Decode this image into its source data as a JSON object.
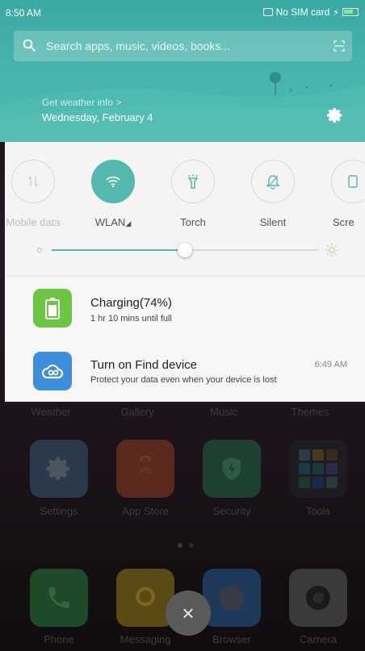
{
  "status_bar": {
    "time": "8:50 AM",
    "sim_text": "No SIM card",
    "battery_level": 0.74,
    "charging_symbol": "⚡"
  },
  "search": {
    "placeholder": "Search apps, music, videos, books..."
  },
  "weather": {
    "link": "Get weather info >",
    "date": "Wednesday, February 4"
  },
  "quick_toggles": [
    {
      "label": "Mobile data",
      "state": "disabled",
      "icon": "mobile-data-icon"
    },
    {
      "label": "WLAN",
      "state": "on",
      "icon": "wifi-icon"
    },
    {
      "label": "Torch",
      "state": "off",
      "icon": "torch-icon"
    },
    {
      "label": "Silent",
      "state": "off",
      "icon": "bell-icon"
    },
    {
      "label": "Scre",
      "state": "off",
      "icon": "screenshot-icon"
    }
  ],
  "brightness": {
    "level": 0.5
  },
  "notifications": [
    {
      "title": "Charging(74%)",
      "text": "1 hr 10 mins  until full",
      "time": "",
      "icon": "battery-icon",
      "color": "#6cc644"
    },
    {
      "title": "Turn on Find device",
      "text": "Protect your data even when your device is lost",
      "time": "6:49 AM",
      "icon": "cloud-icon",
      "color": "#3e8ee0"
    }
  ],
  "home_apps": {
    "row_top_labels": [
      "Weather",
      "Gallery",
      "Music",
      "Themes"
    ],
    "row_mid": [
      {
        "label": "Settings",
        "icon": "gear-icon",
        "color": "#2b3a4a"
      },
      {
        "label": "App Store",
        "icon": "store-icon",
        "color": "#5a2a1e"
      },
      {
        "label": "Security",
        "icon": "shield-icon",
        "color": "#1e4030"
      },
      {
        "label": "Tools",
        "icon": "folder-icon",
        "color": "#1c1c22"
      }
    ],
    "dock": [
      {
        "label": "Phone",
        "icon": "phone-icon",
        "color": "#1f4a2a"
      },
      {
        "label": "Messaging",
        "icon": "message-icon",
        "color": "#5a4a14"
      },
      {
        "label": "Browser",
        "icon": "browser-icon",
        "color": "#1e3a5a"
      },
      {
        "label": "Camera",
        "icon": "camera-icon",
        "color": "#3a3a3a"
      }
    ],
    "store_badge": "mi",
    "close_symbol": "×"
  },
  "colors": {
    "accent": "#53b8ad",
    "header": "#3aa9a2"
  }
}
